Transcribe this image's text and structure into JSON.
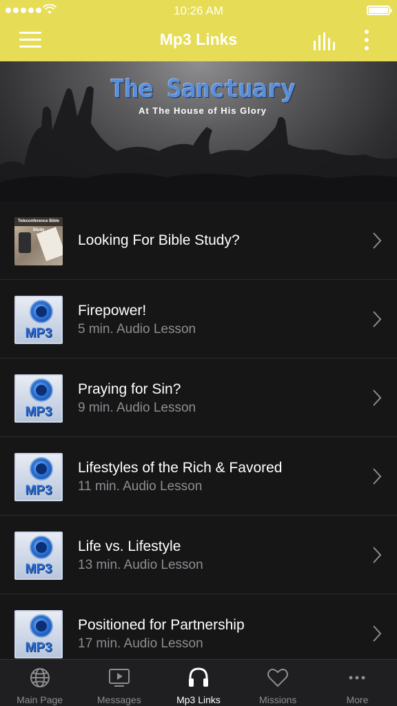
{
  "status_bar": {
    "time": "10:26 AM"
  },
  "nav": {
    "title": "Mp3 Links"
  },
  "banner": {
    "title": "The Sanctuary",
    "subtitle": "At The House of His Glory"
  },
  "list": [
    {
      "title": "Looking For Bible Study?",
      "subtitle": "",
      "thumb_label": "Teleconference Bible Study"
    },
    {
      "title": "Firepower!",
      "subtitle": "5 min. Audio Lesson",
      "thumb_label": "MP3"
    },
    {
      "title": "Praying for Sin?",
      "subtitle": "9 min. Audio Lesson",
      "thumb_label": "MP3"
    },
    {
      "title": "Lifestyles of the Rich & Favored",
      "subtitle": "11 min. Audio Lesson",
      "thumb_label": "MP3"
    },
    {
      "title": "Life vs. Lifestyle",
      "subtitle": "13 min. Audio Lesson",
      "thumb_label": "MP3"
    },
    {
      "title": "Positioned for Partnership",
      "subtitle": "17 min. Audio Lesson",
      "thumb_label": "MP3"
    }
  ],
  "tabs": [
    {
      "label": "Main Page",
      "icon": "globe-icon"
    },
    {
      "label": "Messages",
      "icon": "video-icon"
    },
    {
      "label": "Mp3 Links",
      "icon": "headphones-icon",
      "active": true
    },
    {
      "label": "Missions",
      "icon": "heart-icon"
    },
    {
      "label": "More",
      "icon": "more-icon"
    }
  ],
  "colors": {
    "nav_bar": "#e6dc56",
    "background": "#161617",
    "tab_bar": "#1f1f21",
    "banner_title": "#5a8ed8"
  }
}
